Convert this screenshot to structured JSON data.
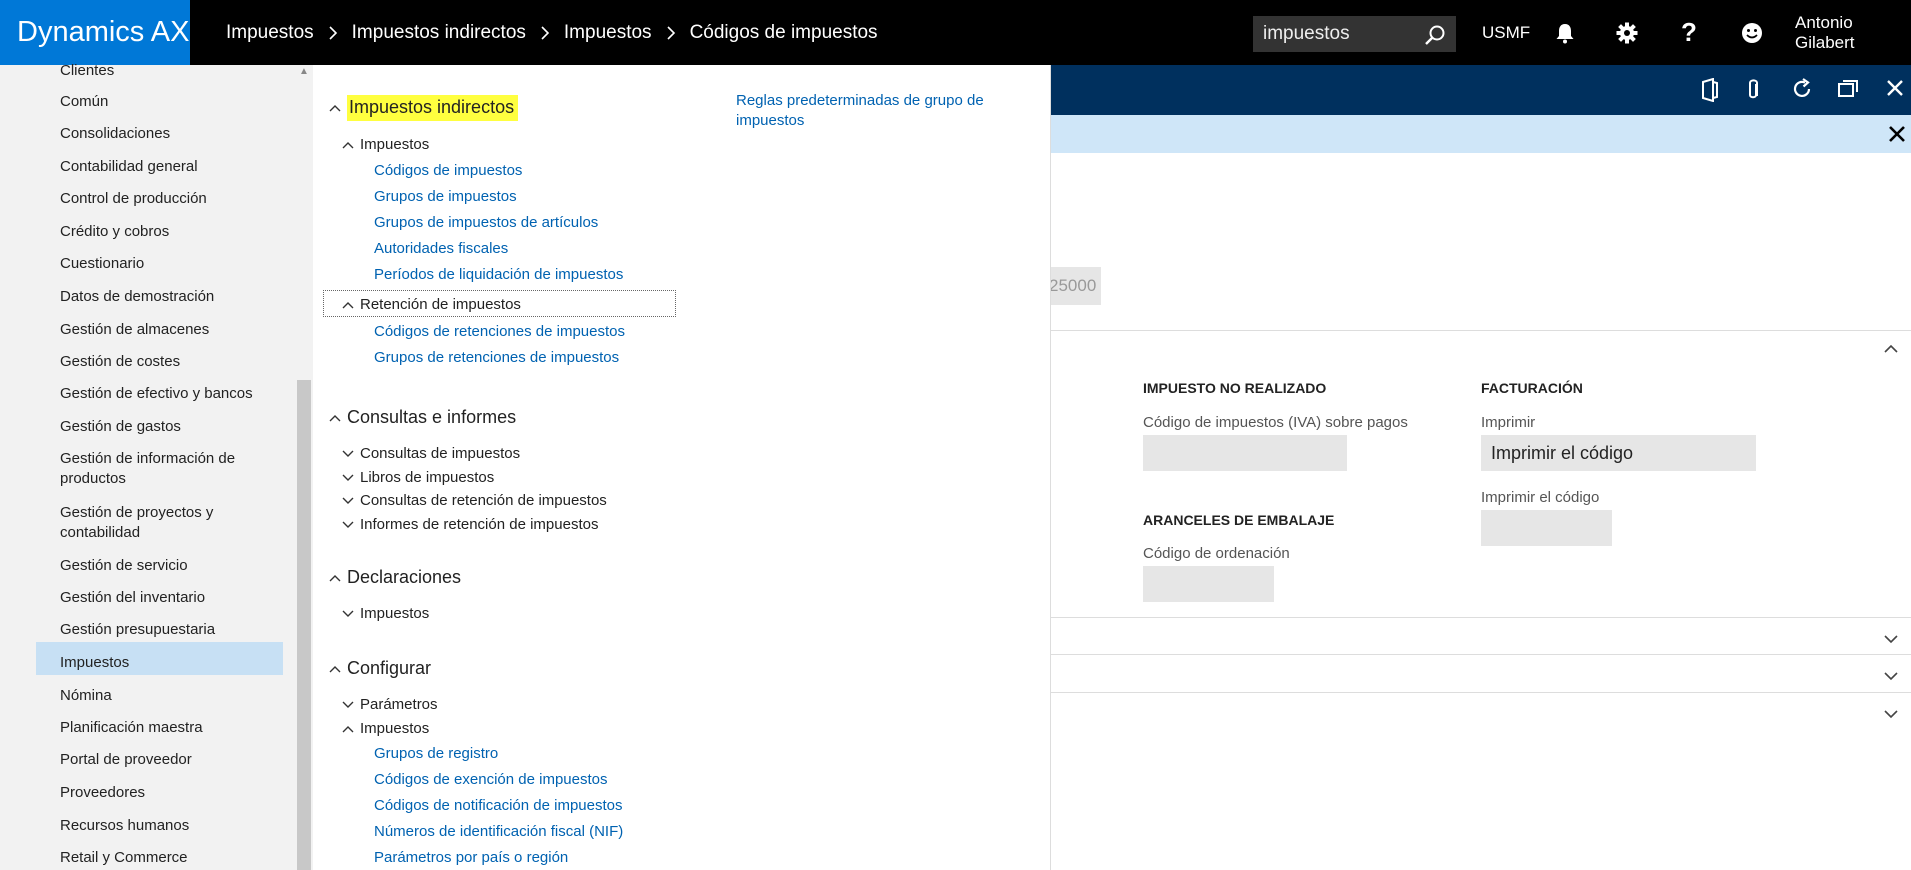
{
  "app": {
    "title": "Dynamics AX"
  },
  "breadcrumb": [
    "Impuestos",
    "Impuestos indirectos",
    "Impuestos",
    "Códigos de impuestos"
  ],
  "search": {
    "value": "impuestos"
  },
  "topbar": {
    "company": "USMF",
    "user": "Antonio Gilabert"
  },
  "leftnav": {
    "items": [
      "Clientes",
      "Común",
      "Consolidaciones",
      "Contabilidad general",
      "Control de producción",
      "Crédito y cobros",
      "Cuestionario",
      "Datos de demostración",
      "Gestión de almacenes",
      "Gestión de costes",
      "Gestión de efectivo y bancos",
      "Gestión de gastos",
      "Gestión de información de productos",
      "Gestión de proyectos y contabilidad",
      "Gestión de servicio",
      "Gestión del inventario",
      "Gestión presupuestaria",
      "Impuestos",
      "Nómina",
      "Planificación maestra",
      "Portal de proveedor",
      "Proveedores",
      "Recursos humanos",
      "Retail y Commerce"
    ],
    "selected": "Impuestos"
  },
  "flyout": {
    "sec_indirect": "Impuestos indirectos",
    "grp_impuestos": "Impuestos",
    "link_codigos": "Códigos de impuestos",
    "link_grupos": "Grupos de impuestos",
    "link_grupos_art": "Grupos de impuestos de artículos",
    "link_autoridades": "Autoridades fiscales",
    "link_periodos": "Períodos de liquidación de impuestos",
    "grp_retencion": "Retención de impuestos",
    "link_cod_ret": "Códigos de retenciones de impuestos",
    "link_grp_ret": "Grupos de retenciones de impuestos",
    "link_reglas": "Reglas predeterminadas de grupo de impuestos",
    "sec_consultas": "Consultas e informes",
    "grp_consultas_imp": "Consultas de impuestos",
    "grp_libros": "Libros de impuestos",
    "grp_consultas_ret": "Consultas de retención de impuestos",
    "grp_informes_ret": "Informes de retención de impuestos",
    "sec_declaraciones": "Declaraciones",
    "grp_decl_impuestos": "Impuestos",
    "sec_configurar": "Configurar",
    "grp_parametros": "Parámetros",
    "grp_conf_impuestos": "Impuestos",
    "link_grupos_registro": "Grupos de registro",
    "link_exencion": "Códigos de exención de impuestos",
    "link_notificacion": "Códigos de notificación de impuestos",
    "link_nif": "Números de identificación fiscal (NIF)",
    "link_parametros_pais": "Parámetros por país o región"
  },
  "background": {
    "field_value_partial": "25000",
    "sect_no_realizado": "IMPUESTO NO REALIZADO",
    "lbl_iva_pagos": "Código de impuestos (IVA) sobre pagos",
    "sect_facturacion": "FACTURACIÓN",
    "lbl_imprimir": "Imprimir",
    "val_imprimir": "Imprimir el código",
    "lbl_imprimir_codigo": "Imprimir el código",
    "sect_aranceles": "ARANCELES DE EMBALAJE",
    "lbl_ordenacion": "Código de ordenación"
  },
  "colors": {
    "brand": "#0078d7",
    "topbar": "#000000",
    "link": "#0062b1",
    "header": "#00305e",
    "infobar": "#cfe6f8",
    "highlight": "#ffff3f",
    "selected": "#c7e0f4"
  }
}
